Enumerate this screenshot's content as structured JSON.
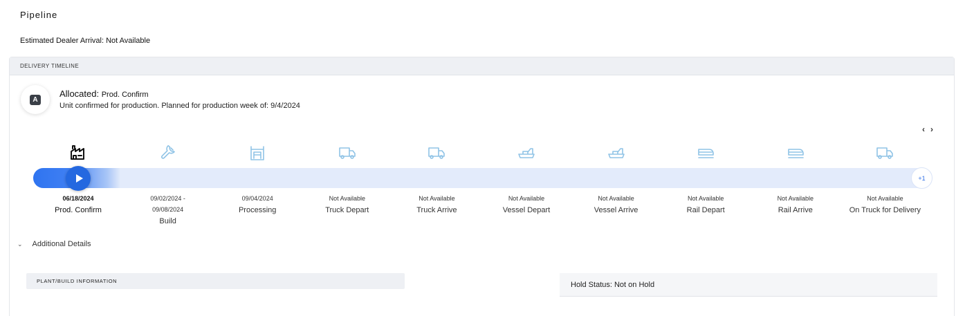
{
  "page": {
    "title": "Pipeline",
    "eta": "Estimated Dealer Arrival: Not Available"
  },
  "timeline": {
    "header": "DELIVERY TIMELINE",
    "status_letter": "A",
    "status_label": "Allocated:",
    "status_value": "Prod. Confirm",
    "status_description": "Unit confirmed for production. Planned for production week of: 9/4/2024",
    "prev_arrow": "‹",
    "next_arrow": "›",
    "more_count": "+1",
    "current_step_index": 0,
    "steps": [
      {
        "icon": "factory-icon",
        "date": "06/18/2024",
        "name": "Prod. Confirm",
        "active": true
      },
      {
        "icon": "wrench-icon",
        "date": "09/02/2024 -\n09/08/2024",
        "name": "Build",
        "active": false
      },
      {
        "icon": "processing-icon",
        "date": "09/04/2024",
        "name": "Processing",
        "active": false
      },
      {
        "icon": "truck-icon",
        "date": "Not Available",
        "name": "Truck Depart",
        "active": false
      },
      {
        "icon": "truck-icon",
        "date": "Not Available",
        "name": "Truck Arrive",
        "active": false
      },
      {
        "icon": "vessel-icon",
        "date": "Not Available",
        "name": "Vessel Depart",
        "active": false
      },
      {
        "icon": "vessel-icon",
        "date": "Not Available",
        "name": "Vessel Arrive",
        "active": false
      },
      {
        "icon": "rail-icon",
        "date": "Not Available",
        "name": "Rail Depart",
        "active": false
      },
      {
        "icon": "rail-icon",
        "date": "Not Available",
        "name": "Rail Arrive",
        "active": false
      },
      {
        "icon": "truck-icon",
        "date": "Not Available",
        "name": "On Truck for Delivery",
        "active": false
      }
    ]
  },
  "details": {
    "toggle_label": "Additional Details",
    "plant_header": "PLANT/BUILD INFORMATION",
    "hold_status": "Hold Status: Not on Hold"
  },
  "colors": {
    "accent": "#2468e0",
    "icon_inactive": "#8fc3e6",
    "icon_active": "#111111"
  }
}
